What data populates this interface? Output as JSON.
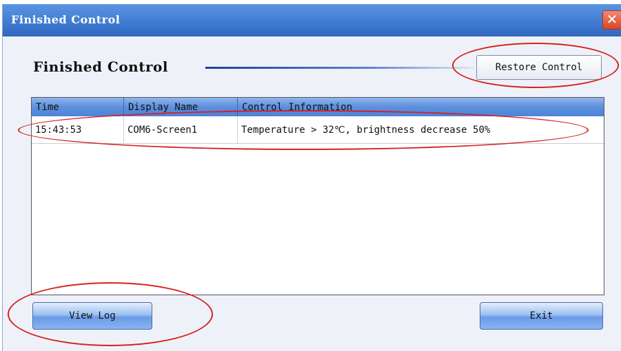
{
  "window": {
    "title": "Finished Control",
    "close_glyph": "✕"
  },
  "heading": "Finished Control",
  "restore_button": "Restore Control",
  "table": {
    "columns": [
      "Time",
      "Display Name",
      "Control Information"
    ],
    "rows": [
      [
        "15:43:53",
        "COM6-Screen1",
        "Temperature > 32℃, brightness decrease 50%"
      ]
    ]
  },
  "buttons": {
    "view_log": "View Log",
    "exit": "Exit"
  },
  "colors": {
    "title_bar": "#3f7ad0",
    "header": "#5c8fde",
    "annotation": "#d62020"
  },
  "icons": {
    "close": "close-icon"
  }
}
